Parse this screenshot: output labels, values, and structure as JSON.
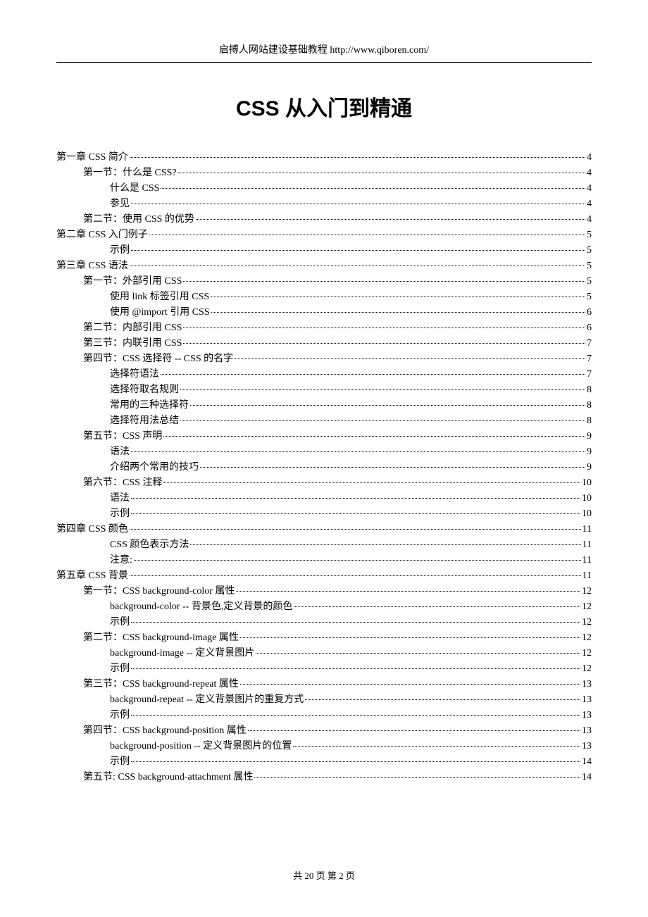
{
  "header": "启搏人网站建设基础教程  http://www.qiboren.com/",
  "title": "CSS 从入门到精通",
  "footer": "共 20 页    第 2 页",
  "toc": [
    {
      "level": 0,
      "label": "第一章  CSS 简介",
      "page": "4"
    },
    {
      "level": 1,
      "label": "第一节：什么是 CSS?",
      "page": "4"
    },
    {
      "level": 2,
      "label": "什么是 CSS",
      "page": "4"
    },
    {
      "level": 2,
      "label": "参见",
      "page": "4"
    },
    {
      "level": 1,
      "label": "第二节：使用 CSS 的优势",
      "page": "4"
    },
    {
      "level": 0,
      "label": "第二章    CSS 入门例子",
      "page": "5"
    },
    {
      "level": 2,
      "label": "示例",
      "page": "5"
    },
    {
      "level": 0,
      "label": "第三章    CSS 语法",
      "page": "5"
    },
    {
      "level": 1,
      "label": "第一节：外部引用 CSS",
      "page": "5"
    },
    {
      "level": 2,
      "label": "使用  link  标签引用 CSS",
      "page": "5"
    },
    {
      "level": 2,
      "label": "使用  @import  引用 CSS",
      "page": "6"
    },
    {
      "level": 1,
      "label": "第二节：内部引用 CSS",
      "page": "6"
    },
    {
      "level": 1,
      "label": "第三节：内联引用 CSS",
      "page": "7"
    },
    {
      "level": 1,
      "label": "第四节：CSS  选择符  -- CSS 的名字",
      "page": "7"
    },
    {
      "level": 2,
      "label": "选择符语法",
      "page": "7"
    },
    {
      "level": 2,
      "label": "选择符取名规则",
      "page": "8"
    },
    {
      "level": 2,
      "label": "常用的三种选择符",
      "page": "8"
    },
    {
      "level": 2,
      "label": "选择符用法总结",
      "page": "8"
    },
    {
      "level": 1,
      "label": "第五节：CSS  声明",
      "page": "9"
    },
    {
      "level": 2,
      "label": "语法",
      "page": "9"
    },
    {
      "level": 2,
      "label": "介绍两个常用的技巧",
      "page": "9"
    },
    {
      "level": 1,
      "label": "第六节：CSS  注释",
      "page": "10"
    },
    {
      "level": 2,
      "label": "语法",
      "page": "10"
    },
    {
      "level": 2,
      "label": "示例",
      "page": "10"
    },
    {
      "level": 0,
      "label": "第四章  CSS 颜色",
      "page": "11"
    },
    {
      "level": 2,
      "label": "CSS 颜色表示方法",
      "page": "11"
    },
    {
      "level": 2,
      "label": "注意:",
      "page": "11"
    },
    {
      "level": 0,
      "label": "第五章      CSS 背景",
      "page": "11"
    },
    {
      "level": 1,
      "label": "第一节：CSS background-color  属性",
      "page": "12"
    },
    {
      "level": 2,
      "label": "background-color --  背景色,定义背景的颜色",
      "page": "12"
    },
    {
      "level": 2,
      "label": "示例",
      "page": "12"
    },
    {
      "level": 1,
      "label": "第二节：CSS background-image  属性",
      "page": "12"
    },
    {
      "level": 2,
      "label": "background-image --  定义背景图片",
      "page": "12"
    },
    {
      "level": 2,
      "label": "示例",
      "page": "12"
    },
    {
      "level": 1,
      "label": "第三节：CSS background-repeat  属性",
      "page": "13"
    },
    {
      "level": 2,
      "label": "background-repeat --  定义背景图片的重复方式",
      "page": "13"
    },
    {
      "level": 2,
      "label": "示例",
      "page": "13"
    },
    {
      "level": 1,
      "label": "第四节：CSS background-position  属性",
      "page": "13"
    },
    {
      "level": 2,
      "label": "background-position --  定义背景图片的位置",
      "page": "13"
    },
    {
      "level": 2,
      "label": "示例",
      "page": "14"
    },
    {
      "level": 1,
      "label": "第五节: CSS background-attachment  属性",
      "page": "14"
    }
  ]
}
